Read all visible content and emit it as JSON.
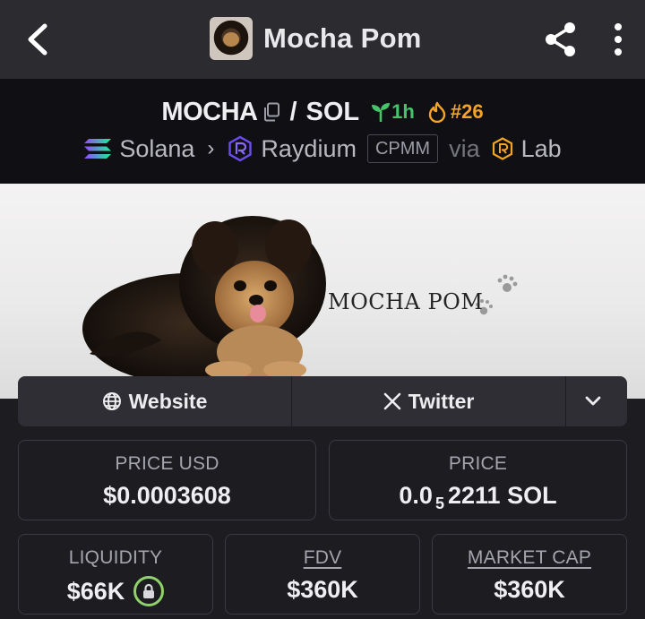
{
  "app_bar": {
    "title": "Mocha Pom"
  },
  "pair": {
    "base_symbol": "MOCHA",
    "separator": "/",
    "quote_symbol": "SOL",
    "age": "1h",
    "rank": "#26",
    "chain": "Solana",
    "dex": "Raydium",
    "pool_type": "CPMM",
    "via_label": "via",
    "launchpad": "Lab"
  },
  "banner": {
    "text": "MOCHA POM"
  },
  "links": {
    "website_label": "Website",
    "twitter_label": "Twitter"
  },
  "stats": {
    "price_usd": {
      "label": "PRICE USD",
      "value": "$0.0003608"
    },
    "price_native": {
      "label": "PRICE",
      "prefix": "0.0",
      "subscript": "5",
      "digits": "2211",
      "unit": "SOL"
    },
    "liquidity": {
      "label": "LIQUIDITY",
      "value": "$66K"
    },
    "fdv": {
      "label": "FDV",
      "value": "$360K"
    },
    "market_cap": {
      "label": "MARKET CAP",
      "value": "$360K"
    }
  },
  "colors": {
    "age_green": "#46c46a",
    "rank_orange": "#f3a423",
    "lock_green": "#8fd16a",
    "raydium_purple": "#6d4cf0"
  },
  "icons": [
    "back-arrow-icon",
    "share-icon",
    "more-vertical-icon",
    "copy-icon",
    "seedling-icon",
    "flame-icon",
    "solana-icon",
    "raydium-icon",
    "lab-icon",
    "globe-icon",
    "x-logo-icon",
    "chevron-down-icon",
    "lock-icon"
  ]
}
